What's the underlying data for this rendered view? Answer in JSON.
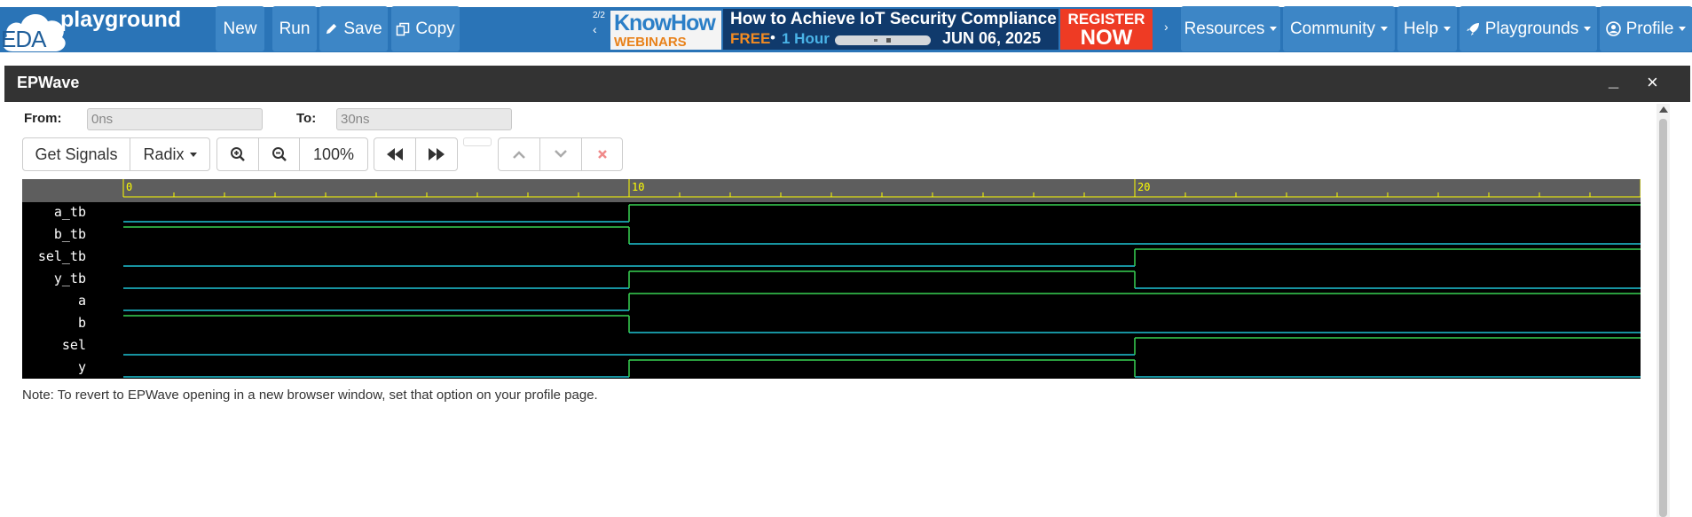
{
  "navbar": {
    "logo_eda": "EDA",
    "logo_text": "playground",
    "buttons": {
      "new": "New",
      "run": "Run",
      "save": "Save",
      "copy": "Copy"
    },
    "menus": {
      "resources": "Resources",
      "community": "Community",
      "help": "Help",
      "playgrounds": "Playgrounds",
      "profile": "Profile"
    },
    "colors": {
      "bar": "#2a74b7",
      "button": "#3d86c6"
    }
  },
  "ad": {
    "pager": "2/2",
    "brand": "KnowHow",
    "brand_sub": "WEBINARS",
    "title": "How to Achieve IoT Security Compliance",
    "free": "FREE",
    "separator": "•",
    "duration": "1 Hour",
    "date": "JUN 06, 2025",
    "cta_line1": "REGISTER",
    "cta_line2": "NOW"
  },
  "modal": {
    "title": "EPWave",
    "minimize": "_",
    "close": "×",
    "from_label": "From:",
    "from_value": "0ns",
    "to_label": "To:",
    "to_value": "30ns",
    "toolbar": {
      "get_signals": "Get Signals",
      "radix": "Radix",
      "zoom_level": "100%"
    },
    "note": "Note: To revert to EPWave opening in a new browser window, set that option on your profile page."
  },
  "waveform": {
    "time_range_ns": [
      0,
      30
    ],
    "ruler_labels": [
      "0",
      "10",
      "20"
    ],
    "colors": {
      "high": "#39d353",
      "low": "#1fc4d6",
      "ruler_text": "#ffff00",
      "ruler_bg": "#5e5e5e"
    },
    "signals": [
      {
        "name": "a_tb",
        "values": [
          0,
          1,
          1
        ]
      },
      {
        "name": "b_tb",
        "values": [
          1,
          0,
          0
        ]
      },
      {
        "name": "sel_tb",
        "values": [
          0,
          0,
          1
        ]
      },
      {
        "name": "y_tb",
        "values": [
          0,
          1,
          0
        ]
      },
      {
        "name": "a",
        "values": [
          0,
          1,
          1
        ]
      },
      {
        "name": "b",
        "values": [
          1,
          0,
          0
        ]
      },
      {
        "name": "sel",
        "values": [
          0,
          0,
          1
        ]
      },
      {
        "name": "y",
        "values": [
          0,
          1,
          0
        ]
      }
    ]
  }
}
